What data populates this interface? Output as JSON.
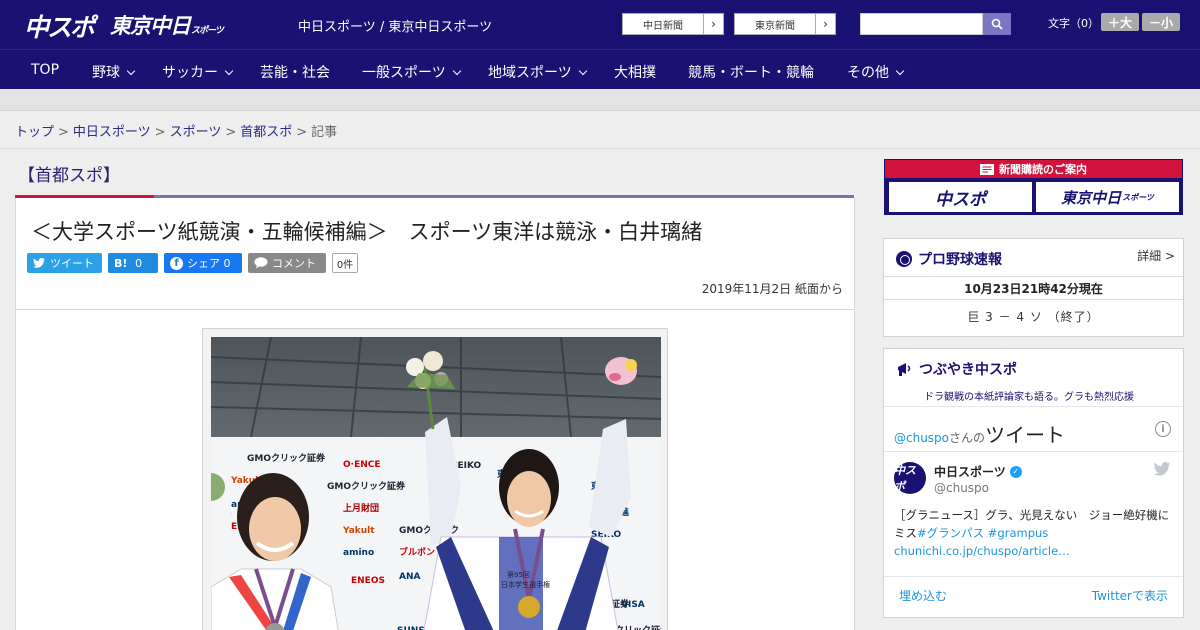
{
  "header": {
    "logo_chuspo": "中スポ",
    "logo_tokyo": "東京中日",
    "logo_tokyo_sub": "スポーツ",
    "site_title": "中日スポーツ / 東京中日スポーツ",
    "ext_links": [
      "中日新聞",
      "東京新聞"
    ],
    "search_placeholder": "",
    "font_size_label": "文字（0）",
    "font_plus": "＋大",
    "font_minus": "－小"
  },
  "nav": {
    "items": [
      {
        "label": "TOP",
        "has_menu": false
      },
      {
        "label": "野球",
        "has_menu": true
      },
      {
        "label": "サッカー",
        "has_menu": true
      },
      {
        "label": "芸能・社会",
        "has_menu": false
      },
      {
        "label": "一般スポーツ",
        "has_menu": true
      },
      {
        "label": "地域スポーツ",
        "has_menu": true
      },
      {
        "label": "大相撲",
        "has_menu": false
      },
      {
        "label": "競馬・ボート・競輪",
        "has_menu": false
      },
      {
        "label": "その他",
        "has_menu": true
      }
    ]
  },
  "breadcrumb": {
    "items": [
      "トップ",
      "中日スポーツ",
      "スポーツ",
      "首都スポ"
    ],
    "current": "記事",
    "separator": ">"
  },
  "section": {
    "title": "【首都スポ】"
  },
  "article": {
    "title": "＜大学スポーツ紙競演・五輪候補編＞　スポーツ東洋は競泳・白井璃緒",
    "share": {
      "tweet": "ツイート",
      "hatena": "B!",
      "hatena_count": "0",
      "facebook": "シェア",
      "facebook_count": "0",
      "comment": "コメント",
      "comment_count": "0件"
    },
    "date": "2019年11月2日 紙面から"
  },
  "sidebar": {
    "promo": {
      "heading": "新聞購読のご案内",
      "logo1": "中スポ",
      "logo2": "東京中日",
      "logo2_sub": "スポーツ"
    },
    "baseball": {
      "title": "プロ野球速報",
      "detail": "詳細 >",
      "updated": "10月23日21時42分現在",
      "score": "巨 3 － 4 ソ （終了）"
    },
    "twitter": {
      "title": "つぶやき中スポ",
      "subtitle": "ドラ観戦の本紙評論家も語る。グラも熱烈応援",
      "handle": "@chuspo",
      "handle_suffix": "さんの",
      "tweets_word": "ツイート",
      "info": "i",
      "avatar_text": "中スポ",
      "user_name": "中日スポーツ",
      "user_id": "@chuspo",
      "text_plain": "［グラニュース］グラ、光見えない　ジョー絶好機にミス",
      "text_tags": "#グランパス #grampus",
      "text_link": "chunichi.co.jp/chuspo/article…",
      "embed": "埋め込む",
      "view_on": "Twitterで表示"
    }
  },
  "colors": {
    "brand_navy": "#1a1272",
    "accent_red": "#d1123a",
    "accent_purple": "#7b72b6",
    "twitter_blue": "#1b95e0"
  }
}
